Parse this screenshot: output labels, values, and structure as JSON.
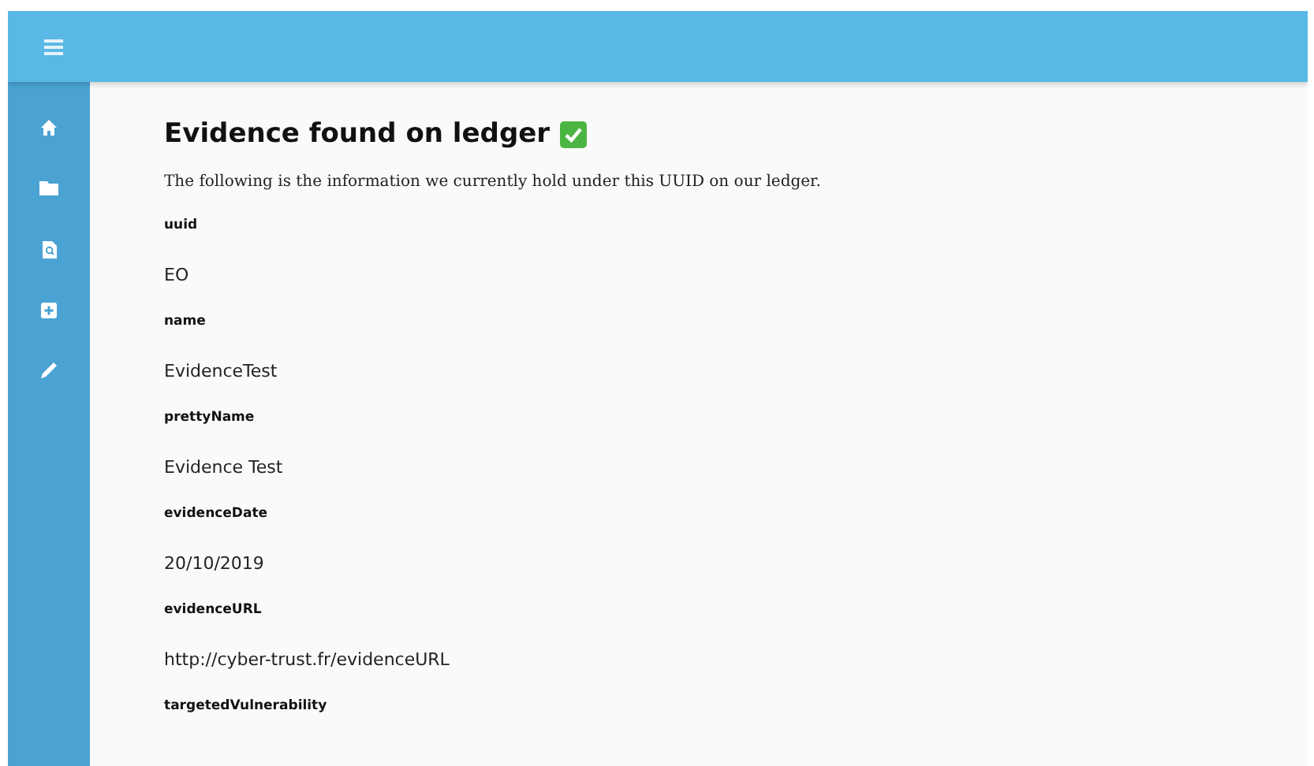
{
  "heading": {
    "title": "Evidence found on ledger",
    "verified": true
  },
  "intro": "The following is the information we currently hold under this UUID on our ledger.",
  "fields": [
    {
      "label": "uuid",
      "value": "EO"
    },
    {
      "label": "name",
      "value": "EvidenceTest"
    },
    {
      "label": "prettyName",
      "value": "Evidence Test"
    },
    {
      "label": "evidenceDate",
      "value": "20/10/2019"
    },
    {
      "label": "evidenceURL",
      "value": "http://cyber-trust.fr/evidenceURL"
    },
    {
      "label": "targetedVulnerability"
    }
  ]
}
